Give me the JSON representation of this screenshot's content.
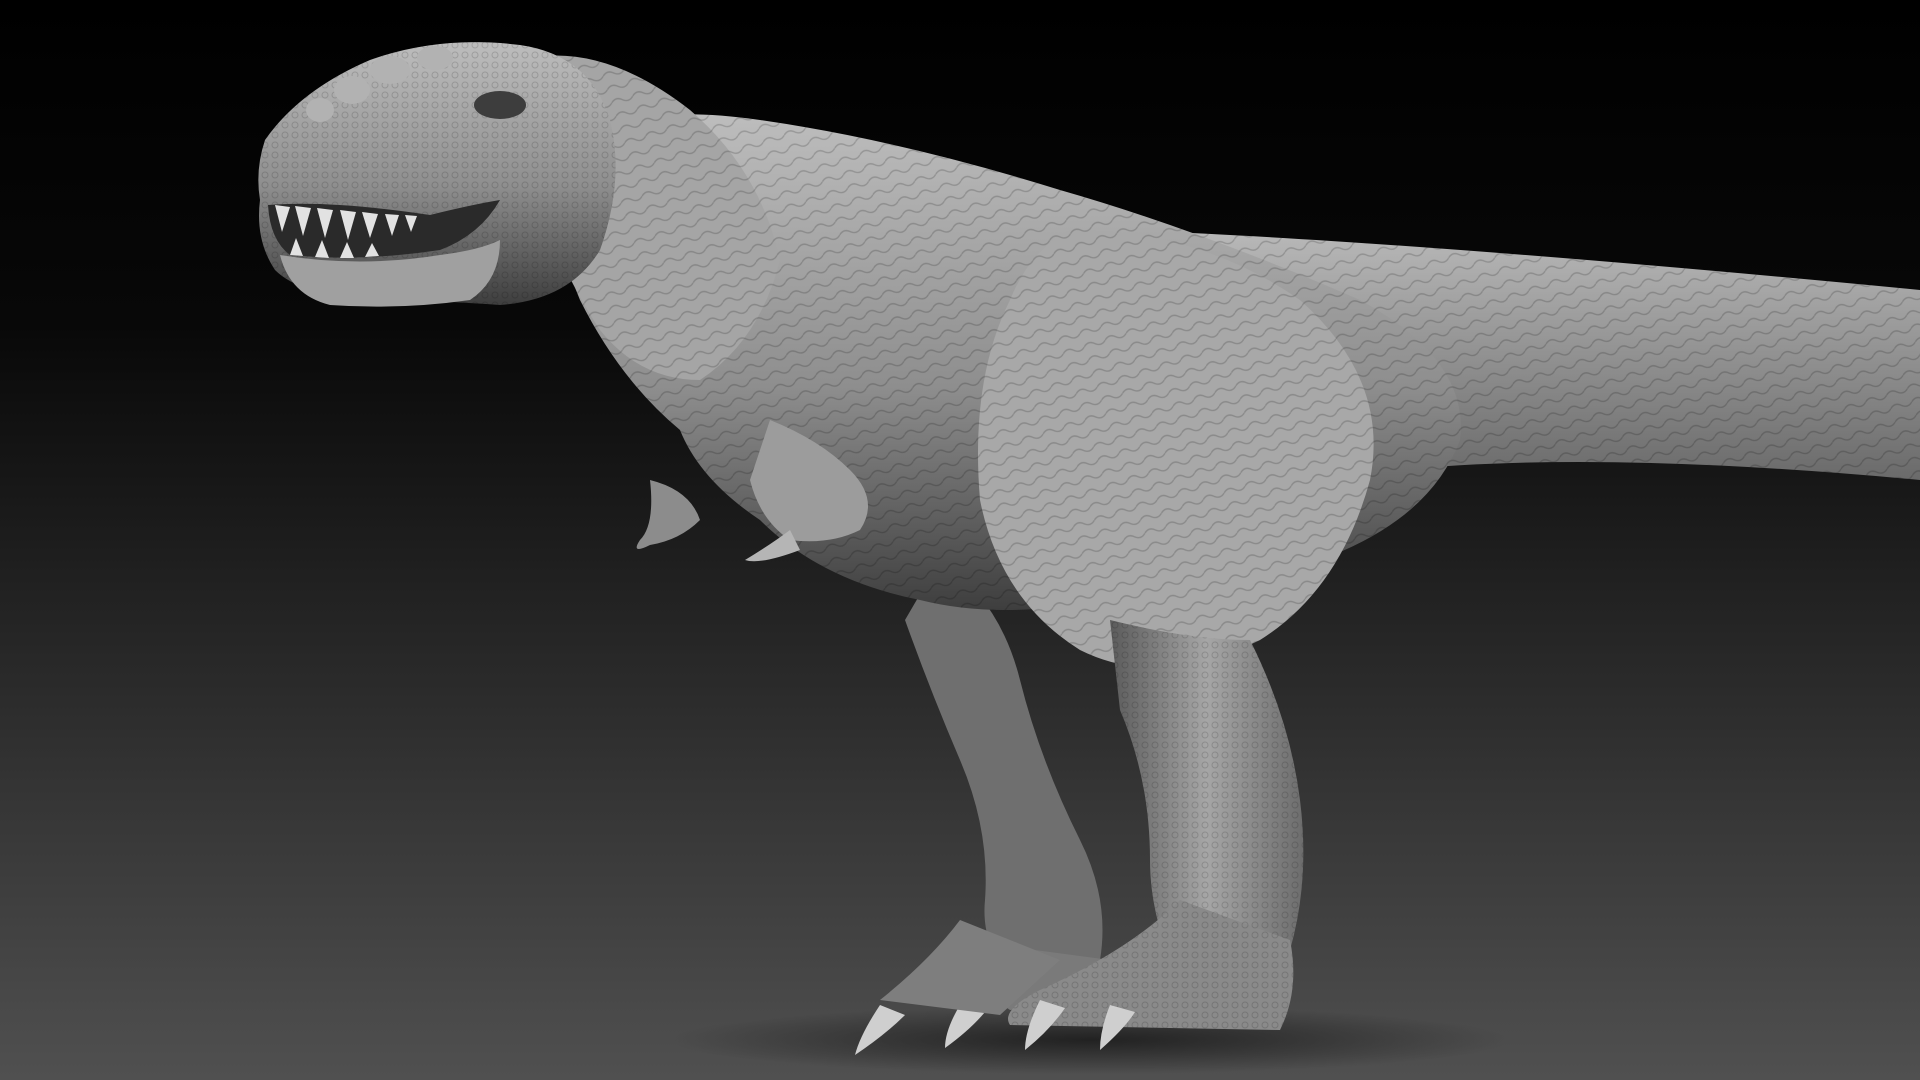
{
  "scene": {
    "subject": "t-rex-sculpt",
    "render_style": "clay-matcap",
    "colors": {
      "background_top": "#000000",
      "background_bottom": "#505050",
      "skin_light": "#bdbdbd",
      "skin_mid": "#8e8e8e",
      "skin_shadow": "#3e3e3e",
      "ground_shadow": "#262626"
    }
  }
}
